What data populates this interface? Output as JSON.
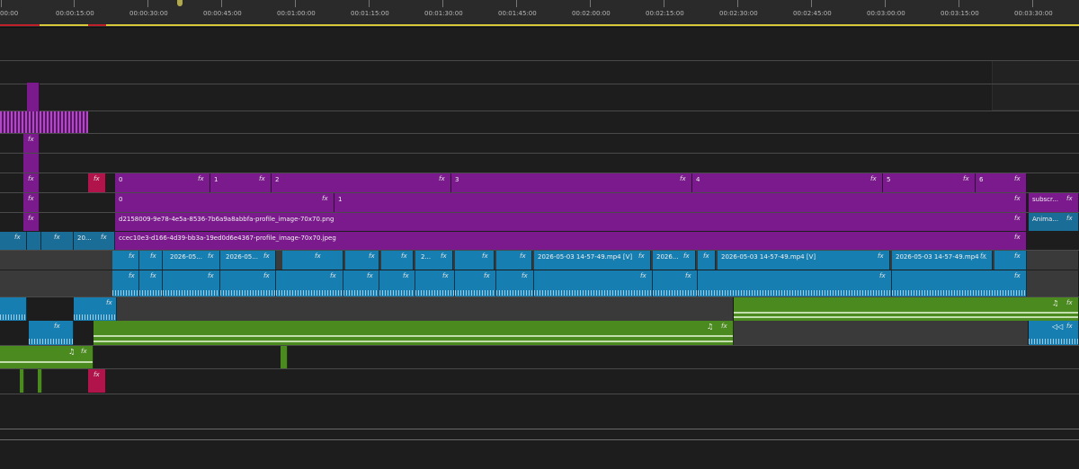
{
  "ruler": {
    "timecodes": [
      "00:00",
      "00:00:15:00",
      "00:00:30:00",
      "00:00:45:00",
      "00:01:00:00",
      "00:01:15:00",
      "00:01:30:00",
      "00:01:45:00",
      "00:02:00:00",
      "00:02:15:00",
      "00:02:30:00",
      "00:02:45:00",
      "00:03:00:00",
      "00:03:15:00",
      "00:03:30:00"
    ]
  },
  "fx_label": "fx",
  "clips": {
    "seq_0": "0",
    "seq_1": "1",
    "seq_2": "2",
    "seq_3": "3",
    "seq_4": "4",
    "seq_5": "5",
    "seq_6": "6",
    "row2_0": "0",
    "row2_1": "1",
    "subscribe": "subscr...",
    "png_image": "d2158009-9e78-4e5a-8536-7b6a9a8abbfa-profile_image-70x70.png",
    "animation": "Anima...",
    "jpeg_image": "ccec10e3-d166-4d39-bb3a-19ed0d6e4367-profile_image-70x70.jpeg",
    "short_20": "20...",
    "video_a": "2026-05...",
    "video_b": "2026-05...",
    "video_c": "2...",
    "video_d": "2026-05-03 14-57-49.mp4 [V]",
    "video_e": "2026...",
    "video_f": "2026-05-03 14-57-49.mp4 [V]",
    "video_g": "2026-05-03 14-57-49.mp4 ..."
  },
  "icons": {
    "music_note": "♫",
    "audio_link": "🔗"
  },
  "colors": {
    "title_purple": "#7b1a8c",
    "video_blue": "#1a6d96",
    "audio_blue": "#167eb0",
    "music_green": "#4b8a1e",
    "adjustment_crimson": "#b0144a",
    "work_area_yellow": "#d6c93a"
  }
}
